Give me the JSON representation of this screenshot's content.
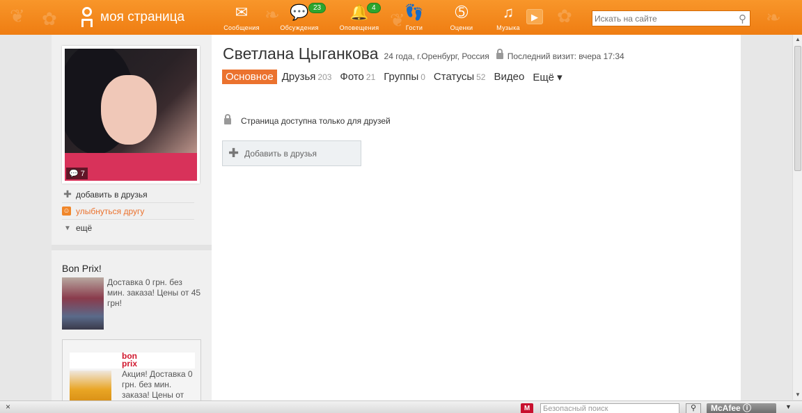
{
  "header": {
    "brand": "моя страница",
    "nav": [
      {
        "label": "Сообщения",
        "icon": "envelope-icon",
        "glyph": "✉",
        "badge": ""
      },
      {
        "label": "Обсуждения",
        "icon": "discussions-icon",
        "glyph": "💬",
        "badge": "23"
      },
      {
        "label": "Оповещения",
        "icon": "bell-icon",
        "glyph": "🔔",
        "badge": "4"
      },
      {
        "label": "Гости",
        "icon": "footprints-icon",
        "glyph": "👣",
        "badge": ""
      },
      {
        "label": "Оценки",
        "icon": "rating-5-icon",
        "glyph": "➄",
        "badge": ""
      },
      {
        "label": "Музыка",
        "icon": "music-note-icon",
        "glyph": "♫",
        "badge": ""
      }
    ],
    "search_placeholder": "Искать на сайте",
    "accent": "#ef7d12"
  },
  "sidebar": {
    "photo_comments": "7",
    "actions": {
      "add_friend": "добавить в друзья",
      "smile": "улыбнуться другу",
      "more": "ещё"
    },
    "ad1": {
      "title": "Bon Prix!",
      "text": "Доставка 0 грн. без мин. заказа! Цены от 45 грн!"
    },
    "ad2": {
      "logo_line1": "bon",
      "logo_line2": "prix",
      "text": "Акция! Доставка 0 грн. без мин. заказа! Цены от"
    }
  },
  "profile": {
    "name": "Светлана Цыганкова",
    "info": "24 года, г.Оренбург, Россия",
    "last_visit": "Последний визит: вчера 17:34",
    "tabs": [
      {
        "label": "Основное",
        "count": ""
      },
      {
        "label": "Друзья",
        "count": "203"
      },
      {
        "label": "Фото",
        "count": "21"
      },
      {
        "label": "Группы",
        "count": "0"
      },
      {
        "label": "Статусы",
        "count": "52"
      },
      {
        "label": "Видео",
        "count": ""
      },
      {
        "label": "Ещё ▾",
        "count": ""
      }
    ],
    "private_notice": "Страница доступна только для друзей",
    "add_friend_button": "Добавить в друзья"
  },
  "bottombar": {
    "close": "×",
    "safe_search_placeholder": "Безопасный поиск",
    "mcafee": "McAfee"
  }
}
